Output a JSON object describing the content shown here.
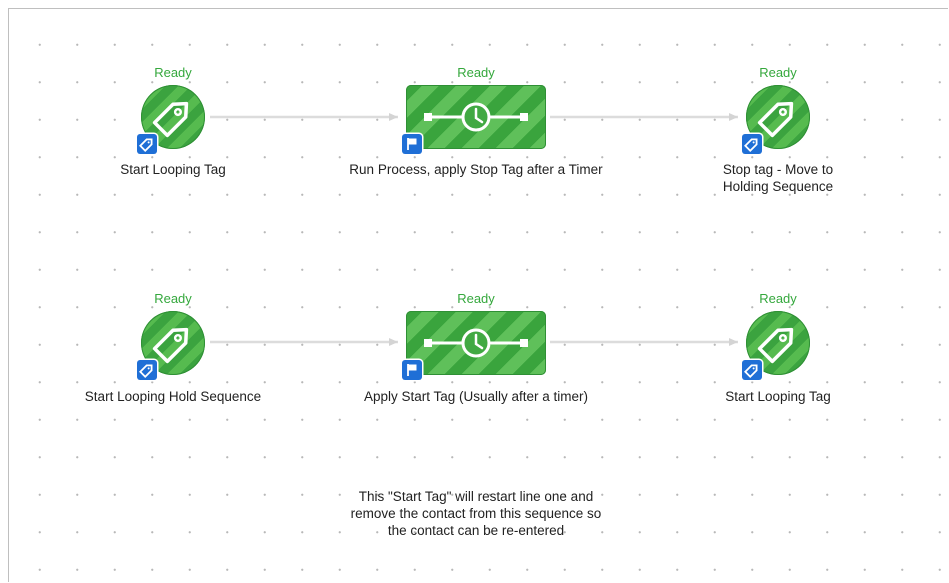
{
  "nodes": [
    {
      "status": "Ready",
      "label": "Start Looping Tag",
      "icon": "tag-icon",
      "badge_icon": "tag-icon"
    },
    {
      "status": "Ready",
      "label": "Run Process, apply Stop Tag after a Timer",
      "icon": "timer-icon",
      "badge_icon": "flag-icon"
    },
    {
      "status": "Ready",
      "label_line1": "Stop tag - Move to",
      "label_line2": "Holding Sequence",
      "icon": "tag-icon",
      "badge_icon": "tag-icon"
    },
    {
      "status": "Ready",
      "label": "Start Looping Hold Sequence",
      "icon": "tag-icon",
      "badge_icon": "tag-icon"
    },
    {
      "status": "Ready",
      "label": "Apply Start Tag (Usually after a timer)",
      "icon": "timer-icon",
      "badge_icon": "flag-icon"
    },
    {
      "status": "Ready",
      "label": "Start Looping Tag",
      "icon": "tag-icon",
      "badge_icon": "tag-icon"
    }
  ],
  "note": {
    "line1": "This \"Start Tag\" will restart line one and",
    "line2": "remove the contact from this sequence so",
    "line3": "the contact can be re-entered"
  },
  "colors": {
    "status_green": "#35a83d",
    "node_green": "#3ba33f",
    "badge_blue": "#1f6fd6",
    "connector": "#d9d9d9"
  }
}
